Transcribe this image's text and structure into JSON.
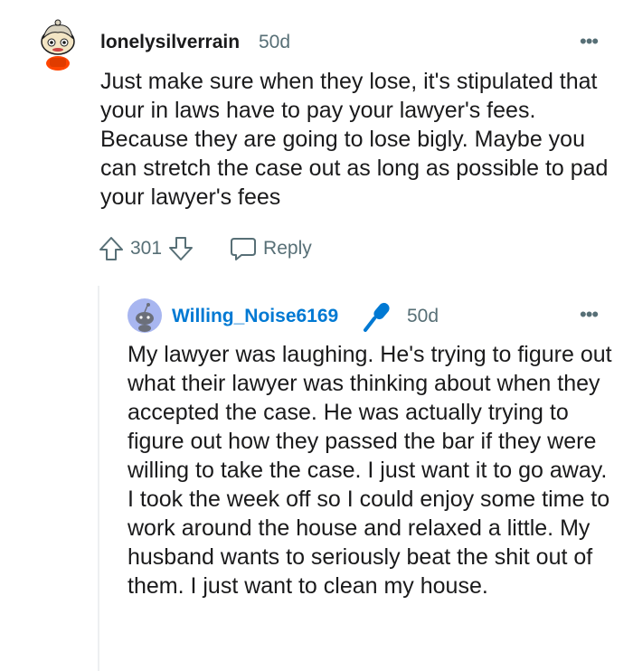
{
  "comment": {
    "username": "lonelysilverrain",
    "age": "50d",
    "more": "•••",
    "body": "Just make sure when they lose, it's stipulated that your in laws have to pay your lawyer's fees. Because they are going to lose bigly. Maybe you can stretch the case out as long as possible to pad your lawyer's fees",
    "score": "301",
    "reply_label": "Reply"
  },
  "reply": {
    "username": "Willing_Noise6169",
    "age": "50d",
    "more": "•••",
    "body": "My lawyer was laughing. He's trying to figure out what their lawyer was thinking about when they accepted the case. He was actually trying to figure out how they passed the bar if they were willing to take the case. I just want it to go away. I took the week off so I could enjoy some time to work around the house and relaxed a little. My husband wants to seriously beat the shit out of them. I just want to clean my house."
  },
  "colors": {
    "username_link": "#0079d3",
    "meta_gray": "#576f76",
    "text": "#1a1a1b",
    "mic_blue": "#0079d3",
    "avatar_orange": "#ff4500"
  }
}
